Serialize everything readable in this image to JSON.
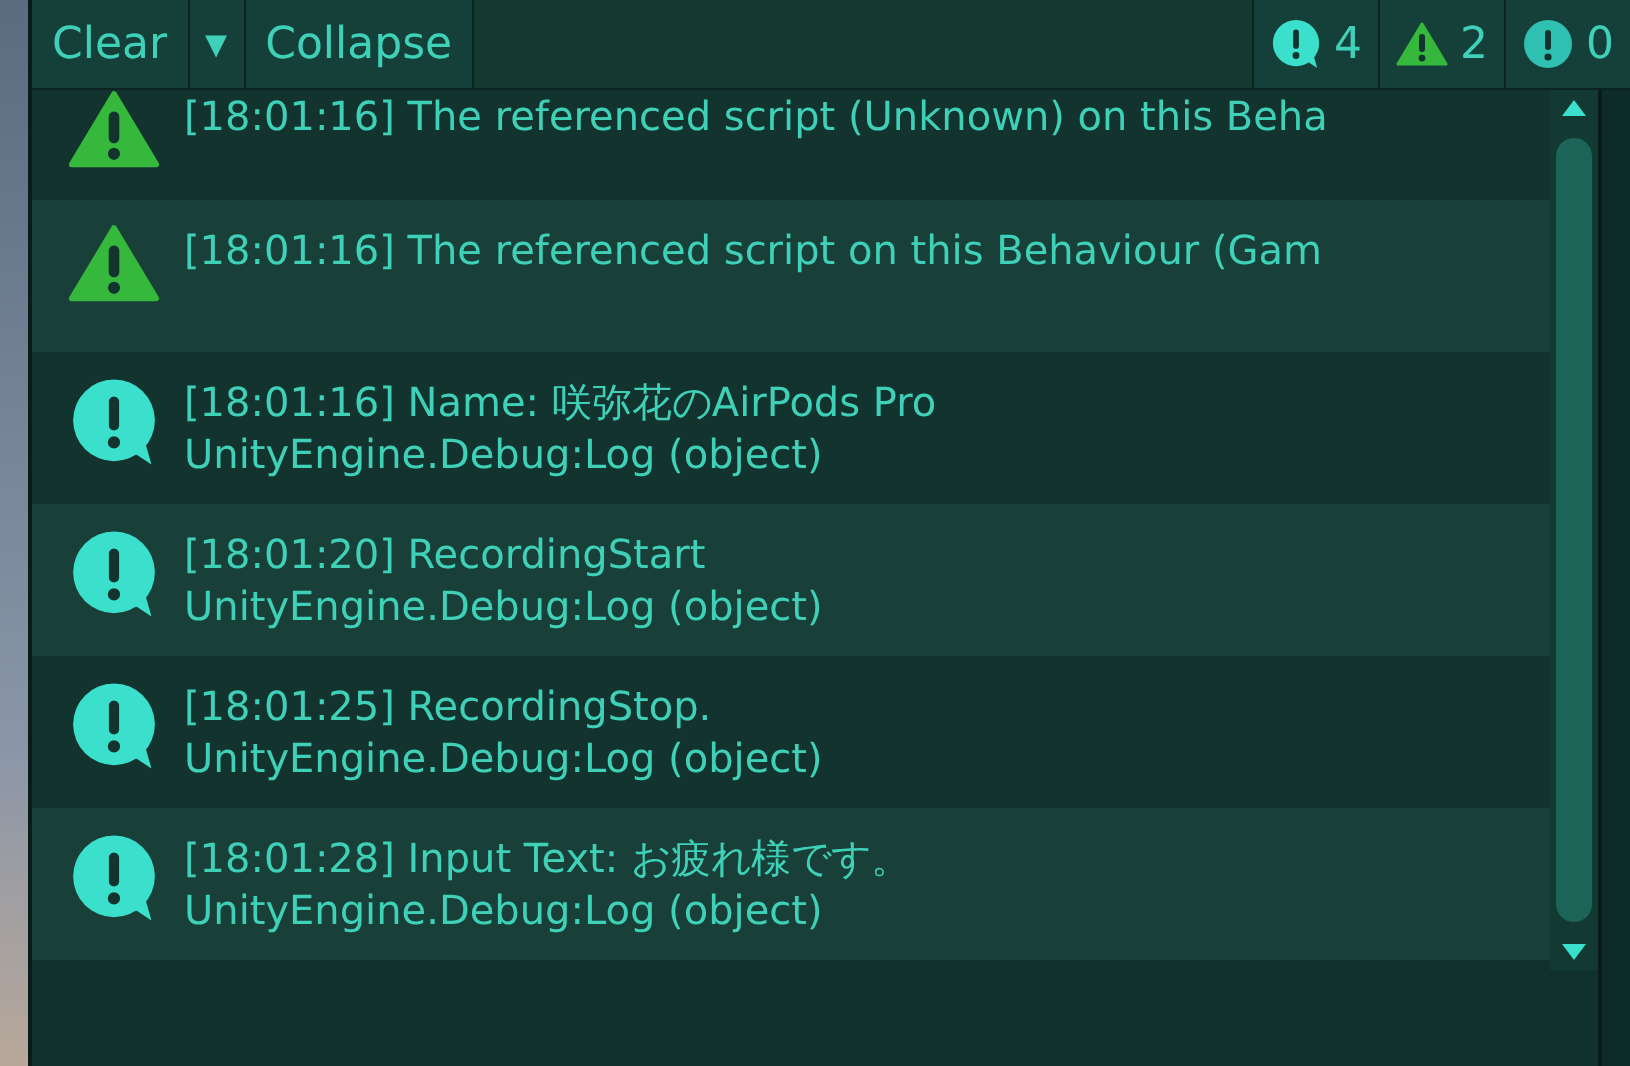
{
  "toolbar": {
    "buttons": [
      {
        "label": "Clear",
        "kind": "button"
      },
      {
        "label": "▾",
        "kind": "dropdown"
      },
      {
        "label": "Collapse",
        "kind": "button"
      }
    ],
    "counters": [
      {
        "kind": "info",
        "count": "4"
      },
      {
        "kind": "warning",
        "count": "2"
      },
      {
        "kind": "error",
        "count": "0"
      }
    ]
  },
  "log": [
    {
      "kind": "warning",
      "lines": [
        "[18:01:16] The referenced script (Unknown) on this Beha"
      ]
    },
    {
      "kind": "warning",
      "lines": [
        "[18:01:16] The referenced script on this Behaviour (Gam"
      ]
    },
    {
      "kind": "info",
      "lines": [
        "[18:01:16] Name: 咲弥花のAirPods Pro",
        "UnityEngine.Debug:Log (object)"
      ]
    },
    {
      "kind": "info",
      "lines": [
        "[18:01:20] RecordingStart",
        "UnityEngine.Debug:Log (object)"
      ]
    },
    {
      "kind": "info",
      "lines": [
        "[18:01:25] RecordingStop.",
        "UnityEngine.Debug:Log (object)"
      ]
    },
    {
      "kind": "info",
      "lines": [
        "[18:01:28] Input Text: お疲れ様です。",
        "UnityEngine.Debug:Log (object)"
      ]
    }
  ]
}
